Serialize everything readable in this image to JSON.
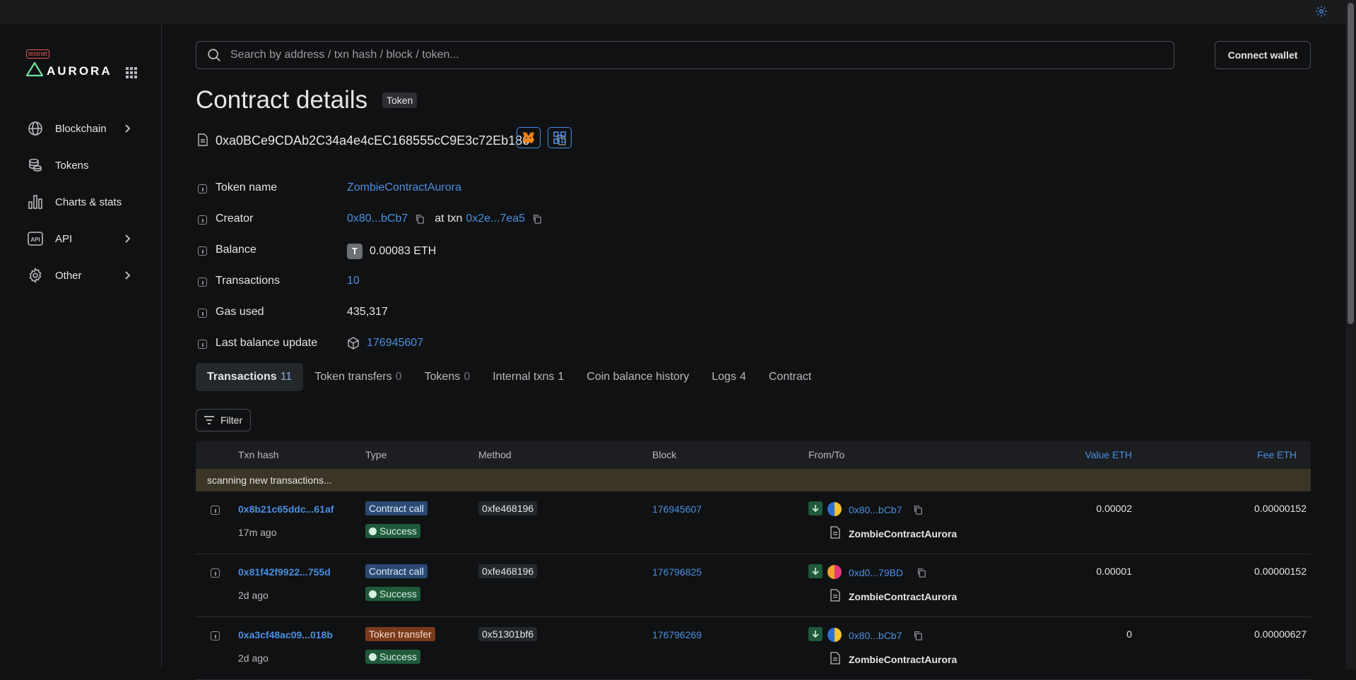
{
  "brand": {
    "testnet": "testnet",
    "name": "AURORA"
  },
  "sidebar": {
    "items": [
      {
        "label": "Blockchain",
        "icon": "globe-icon",
        "chevron": true
      },
      {
        "label": "Tokens",
        "icon": "coins-icon",
        "chevron": false
      },
      {
        "label": "Charts & stats",
        "icon": "bar-chart-icon",
        "chevron": false
      },
      {
        "label": "API",
        "icon": "api-icon",
        "chevron": true
      },
      {
        "label": "Other",
        "icon": "gear-icon",
        "chevron": true
      }
    ]
  },
  "search": {
    "placeholder": "Search by address / txn hash / block / token..."
  },
  "header": {
    "connect_wallet": "Connect wallet"
  },
  "page": {
    "title": "Contract details",
    "tag": "Token",
    "address": "0xa0BCe9CDAb2C34a4e4cEC168555cC9E3c72Eb186"
  },
  "details": {
    "token_name_label": "Token name",
    "token_name": "ZombieContractAurora",
    "creator_label": "Creator",
    "creator": "0x80...bCb7",
    "at_txn": "at txn",
    "creator_txn": "0x2e...7ea5",
    "balance_label": "Balance",
    "balance_badge": "T",
    "balance": "0.00083 ETH",
    "transactions_label": "Transactions",
    "transactions": "10",
    "gas_used_label": "Gas used",
    "gas_used": "435,317",
    "last_balance_update_label": "Last balance update",
    "last_balance_update": "176945607"
  },
  "tabs": [
    {
      "label": "Transactions",
      "count": "11"
    },
    {
      "label": "Token transfers",
      "count": "0"
    },
    {
      "label": "Tokens",
      "count": "0"
    },
    {
      "label": "Internal txns",
      "count": "1"
    },
    {
      "label": "Coin balance history",
      "count": ""
    },
    {
      "label": "Logs",
      "count": "4"
    },
    {
      "label": "Contract",
      "count": ""
    }
  ],
  "filter_label": "Filter",
  "table": {
    "headers": {
      "txn_hash": "Txn hash",
      "type": "Type",
      "method": "Method",
      "block": "Block",
      "from_to": "From/To",
      "value": "Value ETH",
      "fee": "Fee ETH"
    },
    "scanning": "scanning new transactions...",
    "rows": [
      {
        "hash": "0x8b21c65ddc...61af",
        "age": "17m ago",
        "type": "Contract call",
        "status": "Success",
        "method": "0xfe468196",
        "block": "176945607",
        "from": "0x80...bCb7",
        "to": "ZombieContractAurora",
        "value": "0.00002",
        "fee": "0.00000152"
      },
      {
        "hash": "0x81f42f9922...755d",
        "age": "2d ago",
        "type": "Contract call",
        "status": "Success",
        "method": "0xfe468196",
        "block": "176796825",
        "from": "0xd0...79BD",
        "to": "ZombieContractAurora",
        "value": "0.00001",
        "fee": "0.00000152"
      },
      {
        "hash": "0xa3cf48ac09...018b",
        "age": "2d ago",
        "type": "Token transfer",
        "status": "Success",
        "method": "0x51301bf6",
        "block": "176796269",
        "from": "0x80...bCb7",
        "to": "ZombieContractAurora",
        "value": "0",
        "fee": "0.00000627"
      }
    ]
  },
  "colors": {
    "accent": "#4a90e2",
    "background": "#101112",
    "success": "#1f5a3a",
    "contract_call": "#2a4a72",
    "token_transfer": "#7a3a1c"
  }
}
